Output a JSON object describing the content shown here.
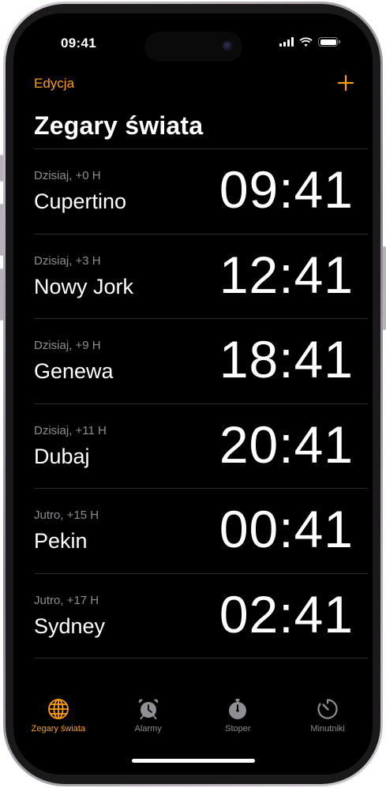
{
  "status_bar": {
    "time": "09:41"
  },
  "header": {
    "edit_label": "Edycja",
    "title": "Zegary świata"
  },
  "colors": {
    "accent": "#ff9f0a",
    "secondary_text": "#8e8e93",
    "background": "#000000"
  },
  "clocks": [
    {
      "offset": "Dzisiaj, +0 H",
      "city": "Cupertino",
      "time": "09:41"
    },
    {
      "offset": "Dzisiaj, +3 H",
      "city": "Nowy Jork",
      "time": "12:41"
    },
    {
      "offset": "Dzisiaj, +9 H",
      "city": "Genewa",
      "time": "18:41"
    },
    {
      "offset": "Dzisiaj, +11 H",
      "city": "Dubaj",
      "time": "20:41"
    },
    {
      "offset": "Jutro, +15 H",
      "city": "Pekin",
      "time": "00:41"
    },
    {
      "offset": "Jutro, +17 H",
      "city": "Sydney",
      "time": "02:41"
    }
  ],
  "tabbar": {
    "tabs": [
      {
        "label": "Zegary świata",
        "icon": "globe-icon",
        "active": true
      },
      {
        "label": "Alarmy",
        "icon": "alarm-clock-icon",
        "active": false
      },
      {
        "label": "Stoper",
        "icon": "stopwatch-icon",
        "active": false
      },
      {
        "label": "Minutniki",
        "icon": "timer-icon",
        "active": false
      }
    ]
  }
}
